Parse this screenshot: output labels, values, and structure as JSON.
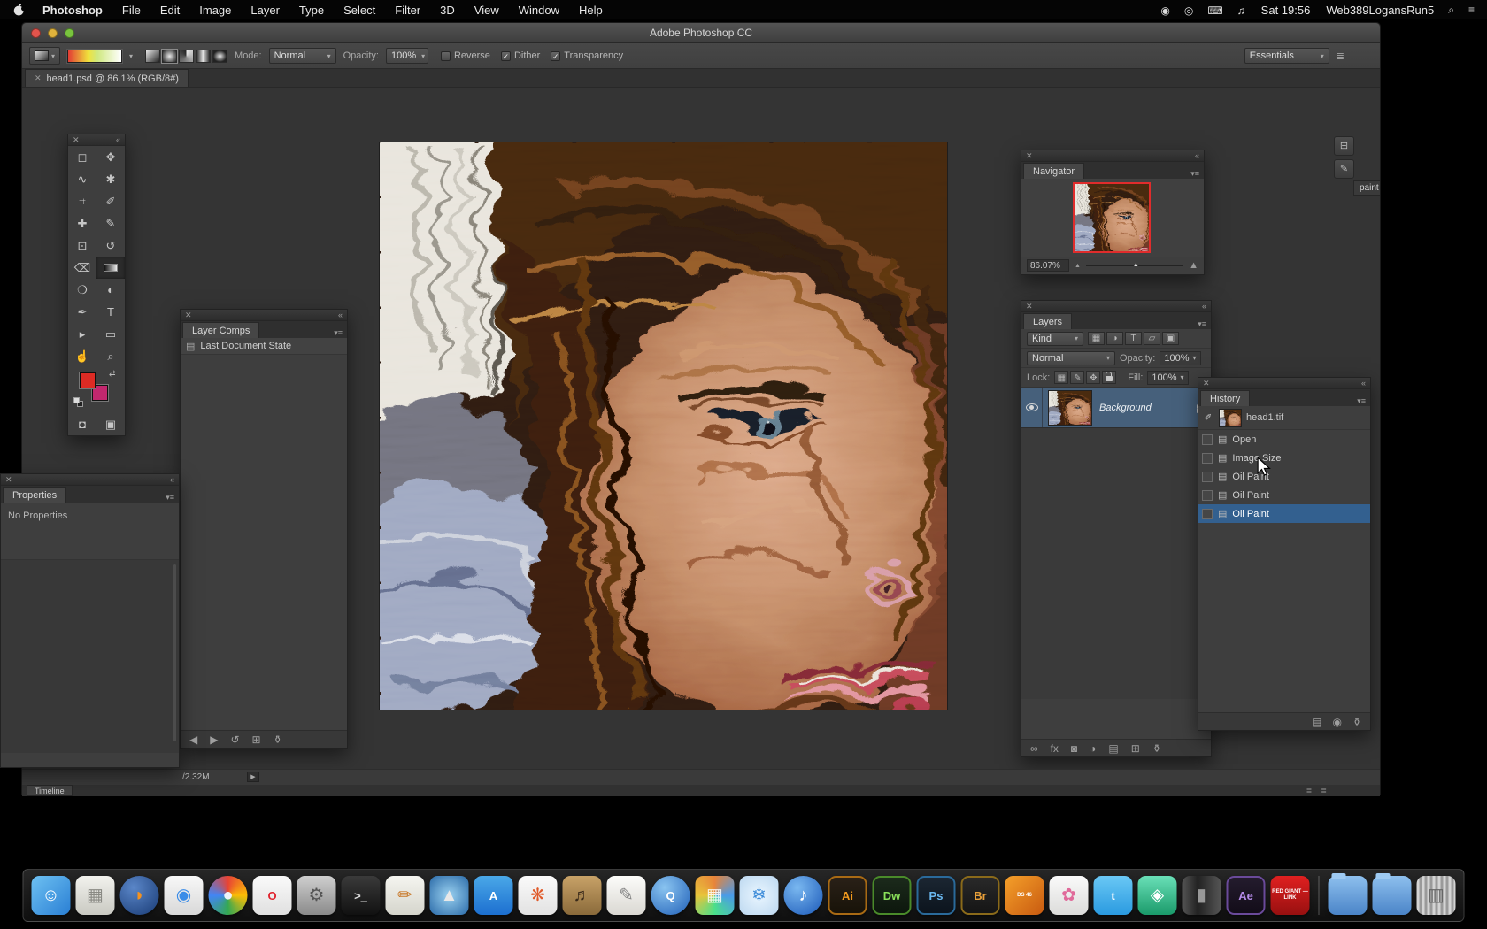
{
  "menubar": {
    "app_name": "Photoshop",
    "items": [
      "File",
      "Edit",
      "Image",
      "Layer",
      "Type",
      "Select",
      "Filter",
      "3D",
      "View",
      "Window",
      "Help"
    ],
    "status_icons": [
      {
        "name": "record-icon",
        "glyph": "◉"
      },
      {
        "name": "screen-share-icon",
        "glyph": "◎"
      },
      {
        "name": "keyboard-icon",
        "glyph": "⌨"
      },
      {
        "name": "volume-icon",
        "glyph": "♫"
      }
    ],
    "time": "Sat 19:56",
    "account": "Web389LogansRun5",
    "right_icons": [
      {
        "name": "spotlight-icon",
        "glyph": "⌕"
      },
      {
        "name": "notification-center-icon",
        "glyph": "≡"
      }
    ]
  },
  "window": {
    "title": "Adobe Photoshop CC"
  },
  "options": {
    "mode_label": "Mode:",
    "mode_value": "Normal",
    "opacity_label": "Opacity:",
    "opacity_value": "100%",
    "checkboxes": [
      {
        "label": "Reverse",
        "checked": false
      },
      {
        "label": "Dither",
        "checked": true
      },
      {
        "label": "Transparency",
        "checked": true
      }
    ],
    "gradient_types": [
      "linear",
      "radial",
      "angle",
      "reflected",
      "diamond"
    ],
    "active_gradient_type": 1,
    "workspace": "Essentials"
  },
  "doc_tab": {
    "title": "head1.psd @ 86.1% (RGB/8#)"
  },
  "collapsed_dock": {
    "label": "paint"
  },
  "toolbar": {
    "tools": [
      {
        "name": "rect-marquee",
        "glyph": "◻"
      },
      {
        "name": "move",
        "glyph": "✥"
      },
      {
        "name": "lasso",
        "glyph": "∿"
      },
      {
        "name": "magic-wand",
        "glyph": "✱"
      },
      {
        "name": "crop",
        "glyph": "⌗"
      },
      {
        "name": "eyedropper",
        "glyph": "✐"
      },
      {
        "name": "healing-brush",
        "glyph": "✚"
      },
      {
        "name": "brush",
        "glyph": "✎"
      },
      {
        "name": "clone-stamp",
        "glyph": "⊡"
      },
      {
        "name": "history-brush",
        "glyph": "↺"
      },
      {
        "name": "eraser",
        "glyph": "⌫"
      },
      {
        "name": "gradient",
        "glyph": "",
        "selected": true
      },
      {
        "name": "blur",
        "glyph": "❍"
      },
      {
        "name": "dodge",
        "glyph": "◐"
      },
      {
        "name": "pen",
        "glyph": "✒"
      },
      {
        "name": "type",
        "glyph": "T"
      },
      {
        "name": "path-selection",
        "glyph": "▸"
      },
      {
        "name": "rectangle",
        "glyph": "▭"
      },
      {
        "name": "hand",
        "glyph": "☝"
      },
      {
        "name": "zoom",
        "glyph": "⌕"
      }
    ],
    "bottom": [
      {
        "name": "quick-mask-button",
        "glyph": "◘"
      },
      {
        "name": "screen-mode-button",
        "glyph": "▣"
      }
    ]
  },
  "layer_comps": {
    "title": "Layer Comps",
    "items": [
      "Last Document State"
    ],
    "bottom_icons": [
      {
        "name": "apply-previous-icon",
        "glyph": "◀"
      },
      {
        "name": "apply-next-icon",
        "glyph": "▶"
      },
      {
        "name": "update-comp-icon",
        "glyph": "↺"
      },
      {
        "name": "new-comp-icon",
        "glyph": "⊞"
      },
      {
        "name": "delete-comp-icon",
        "glyph": "⚱"
      }
    ]
  },
  "properties": {
    "title": "Properties",
    "empty_text": "No Properties"
  },
  "navigator": {
    "title": "Navigator",
    "zoom": "86.07%"
  },
  "layers": {
    "title": "Layers",
    "kind_label": "Kind",
    "filter_icons": [
      {
        "name": "filter-pixel-icon",
        "glyph": "▦"
      },
      {
        "name": "filter-adjustment-icon",
        "glyph": "◑"
      },
      {
        "name": "filter-type-icon",
        "glyph": "T"
      },
      {
        "name": "filter-shape-icon",
        "glyph": "▱"
      },
      {
        "name": "filter-smart-icon",
        "glyph": "▣"
      }
    ],
    "blend_mode": "Normal",
    "opacity_label": "Opacity:",
    "opacity_value": "100%",
    "lock_label": "Lock:",
    "lock_icons": [
      {
        "name": "lock-transparency-icon",
        "glyph": "▦"
      },
      {
        "name": "lock-pixels-icon",
        "glyph": "✎"
      },
      {
        "name": "lock-position-icon",
        "glyph": "✥"
      },
      {
        "name": "lock-all-icon",
        "glyph": "LOCK"
      }
    ],
    "fill_label": "Fill:",
    "fill_value": "100%",
    "layer_name": "Background",
    "bottom_icons": [
      {
        "name": "link-layers-icon",
        "glyph": "∞"
      },
      {
        "name": "layer-style-icon",
        "glyph": "fx"
      },
      {
        "name": "layer-mask-icon",
        "glyph": "◙"
      },
      {
        "name": "adjustment-layer-icon",
        "glyph": "◑"
      },
      {
        "name": "layer-group-icon",
        "glyph": "▤"
      },
      {
        "name": "new-layer-icon",
        "glyph": "⊞"
      },
      {
        "name": "delete-layer-icon",
        "glyph": "⚱"
      }
    ]
  },
  "history": {
    "title": "History",
    "snapshot": "head1.tif",
    "items": [
      {
        "label": "Open",
        "selected": false
      },
      {
        "label": "Image Size",
        "selected": false
      },
      {
        "label": "Oil Paint",
        "selected": false
      },
      {
        "label": "Oil Paint",
        "selected": false
      },
      {
        "label": "Oil Paint",
        "selected": true
      }
    ],
    "bottom_icons": [
      {
        "name": "new-doc-from-state-icon",
        "glyph": "▤"
      },
      {
        "name": "new-snapshot-icon",
        "glyph": "◉"
      },
      {
        "name": "delete-state-icon",
        "glyph": "⚱"
      }
    ]
  },
  "status": {
    "doc_size": "/2.32M"
  },
  "timeline": {
    "label": "Timeline"
  },
  "colors": {
    "foreground": "#dd2b24",
    "background": "#c2276e",
    "layer_selected": "#46607b",
    "history_selected": "#33608f",
    "proxy_border": "#e02c2c",
    "gradient_preview": "linear-gradient(90deg,#e23b34 0%,#f0e23c 38%,#cfe87f 55%,#ffffff 100%)"
  },
  "icons": {
    "close": "✕",
    "collapse": "«",
    "panel_menu": "▾≡",
    "dropdown": "▾",
    "check": "✓",
    "state": "▤",
    "hamburger": "≣",
    "play": "▶",
    "tri": "▲",
    "brush_source": "✐",
    "swap": "⇄",
    "search": "⌕",
    "options_menu": "≣",
    "collapsed_panel_a": "⊞",
    "collapsed_panel_b": "✎"
  },
  "dock": {
    "apps": [
      {
        "name": "finder",
        "bg": "linear-gradient(135deg,#6ec1f2,#2a7fd4)",
        "glyph": "☺",
        "fg": "#ffffff"
      },
      {
        "name": "preview",
        "bg": "linear-gradient(#f2f2ee,#c9c9c2)",
        "glyph": "▦",
        "fg": "#8a8a84"
      },
      {
        "name": "firefox",
        "bg": "radial-gradient(circle at 35% 30%,#5a86c8,#183a74)",
        "glyph": "◗",
        "fg": "#f5921e",
        "shape": "circle"
      },
      {
        "name": "safari",
        "bg": "linear-gradient(#f8f8f8,#d8d8d8)",
        "glyph": "◉",
        "fg": "#3a8ce8"
      },
      {
        "name": "chrome",
        "bg": "conic-gradient(#e84335,#fbbc05,#34a853,#4285f4,#e84335)",
        "glyph": "●",
        "fg": "#eef3fa",
        "shape": "circle"
      },
      {
        "name": "opera",
        "bg": "linear-gradient(#fafafa,#e0e0e0)",
        "glyph": "O",
        "fg": "#e0242e",
        "small": true
      },
      {
        "name": "system-preferences",
        "bg": "linear-gradient(#cfcfcf,#8a8a8a)",
        "glyph": "⚙",
        "fg": "#555555"
      },
      {
        "name": "terminal",
        "bg": "linear-gradient(#3a3a3a,#111111)",
        "glyph": ">_",
        "fg": "#dddddd",
        "small": true
      },
      {
        "name": "pencils",
        "bg": "linear-gradient(#f5f5f0,#d5d5cc)",
        "glyph": "✏",
        "fg": "#c87828"
      },
      {
        "name": "launchpad",
        "bg": "radial-gradient(circle,#9ad1f0,#2a6aa8)",
        "glyph": "▲",
        "fg": "#e8e8e8"
      },
      {
        "name": "app-store",
        "bg": "linear-gradient(#4aa8e8,#1c6fd0)",
        "glyph": "A",
        "fg": "#ffffff",
        "small": true
      },
      {
        "name": "picasa",
        "bg": "linear-gradient(#fafafa,#e2e2e2)",
        "glyph": "❋",
        "fg": "#e05a2a"
      },
      {
        "name": "garageband",
        "bg": "linear-gradient(#c8a268,#8a6a3a)",
        "glyph": "♬",
        "fg": "#3a2a1a"
      },
      {
        "name": "textedit",
        "bg": "linear-gradient(#fcfcfa,#dad8d2)",
        "glyph": "✎",
        "fg": "#888888"
      },
      {
        "name": "quicktime",
        "bg": "radial-gradient(circle at 35% 30%,#8ac4f0,#2060b8)",
        "glyph": "Q",
        "fg": "#ffffff",
        "shape": "circle",
        "small": true
      },
      {
        "name": "mosaic-app",
        "bg": "conic-gradient(#e8843a,#4a9ae8,#4ae08a,#e8c43a,#e8843a)",
        "glyph": "▦",
        "fg": "rgba(255,255,255,.85)"
      },
      {
        "name": "snowflake-app",
        "bg": "radial-gradient(#eaf6ff,#bcd8f0)",
        "glyph": "❄",
        "fg": "#3a8ad8"
      },
      {
        "name": "itunes",
        "bg": "radial-gradient(circle at 35% 30%,#7ab8f0,#1a58b8)",
        "glyph": "♪",
        "fg": "#ffffff",
        "shape": "circle"
      },
      {
        "name": "illustrator",
        "bg": "linear-gradient(#2a2118,#171208)",
        "glyph": "Ai",
        "fg": "#f29a1e",
        "border": "#a86a14",
        "small": true
      },
      {
        "name": "dreamweaver",
        "bg": "linear-gradient(#1c2b1c,#0c160c)",
        "glyph": "Dw",
        "fg": "#8ae05a",
        "border": "#4a8a2a",
        "small": true
      },
      {
        "name": "photoshop",
        "bg": "linear-gradient(#1c2733,#0b131c)",
        "glyph": "Ps",
        "fg": "#6ab8f0",
        "border": "#2a6a9a",
        "small": true
      },
      {
        "name": "bridge",
        "bg": "linear-gradient(#2a2a2a,#141414)",
        "glyph": "Br",
        "fg": "#e8a03a",
        "border": "#8a6a1a",
        "small": true
      },
      {
        "name": "daz-studio",
        "bg": "linear-gradient(135deg,#f5a02a,#c85a10)",
        "label": "DS 46",
        "fg": "#ffffff"
      },
      {
        "name": "photos",
        "bg": "linear-gradient(#fafafa,#dcdcda)",
        "glyph": "✿",
        "fg": "#e06a9a"
      },
      {
        "name": "twitter",
        "bg": "linear-gradient(#6ac8f5,#2a9ae0)",
        "glyph": "t",
        "fg": "#ffffff",
        "small": true
      },
      {
        "name": "teal-app",
        "bg": "linear-gradient(#6ae0b8,#1a9a6a)",
        "glyph": "◈",
        "fg": "#ffffff"
      },
      {
        "name": "barrel-app",
        "bg": "linear-gradient(90deg,#555555,#222222 40%,#555555)",
        "glyph": "▮",
        "fg": "#999999"
      },
      {
        "name": "after-effects",
        "bg": "linear-gradient(#241c2e,#120c18)",
        "glyph": "Ae",
        "fg": "#b48ae8",
        "border": "#6a4a9a",
        "small": true
      },
      {
        "name": "red-giant-link",
        "bg": "linear-gradient(#e02020,#981010)",
        "label": "RED GIANT —LINK",
        "fg": "#ffffff"
      },
      {
        "separator": true
      },
      {
        "name": "folder-1",
        "bg": "linear-gradient(#8ec0ee,#4a84c8)",
        "glyph": "",
        "fg": "#ffffff",
        "kind": "folder"
      },
      {
        "name": "folder-2",
        "bg": "linear-gradient(#8ec0ee,#4a84c8)",
        "glyph": "",
        "fg": "#ffffff",
        "kind": "folder"
      },
      {
        "name": "trash",
        "bg": "repeating-linear-gradient(90deg,#d4d4d4 0 3px,#9a9a9a 3px 6px)",
        "glyph": "▥",
        "fg": "#666666"
      }
    ]
  }
}
